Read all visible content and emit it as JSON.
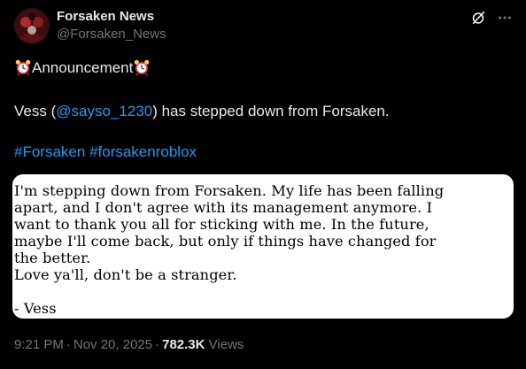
{
  "author": {
    "display_name": "Forsaken News",
    "handle": "@Forsaken_News",
    "avatar_icon": "forsaken-logo-avatar"
  },
  "actions": {
    "grok_icon": "slash-circle-icon",
    "more_icon": "more-dots-icon"
  },
  "post": {
    "announcement_emoji": "alarm-clock-emoji",
    "announcement_label": "Announcement",
    "line2_prefix": "Vess (",
    "mention": "@sayso_1230",
    "line2_suffix": ") has stepped down from Forsaken.",
    "hashtags": [
      "#Forsaken",
      "#forsakenroblox"
    ]
  },
  "attached_note": {
    "lines": [
      "I'm stepping down from Forsaken. My life has been falling",
      "apart, and I don't agree with its management anymore. I",
      "want to thank you all for sticking with me. In the future,",
      "maybe I'll come back, but only if things have changed for",
      "the better.",
      "Love ya'll, don't be a stranger.",
      "",
      "- Vess"
    ]
  },
  "meta": {
    "time": "9:21 PM",
    "date": "Nov 20, 2025",
    "views_count": "782.3K",
    "views_label": "Views"
  },
  "colors": {
    "background": "#000000",
    "text": "#e7e9ea",
    "secondary": "#71767b",
    "link": "#1d9bf0",
    "card_bg": "#ffffff"
  }
}
